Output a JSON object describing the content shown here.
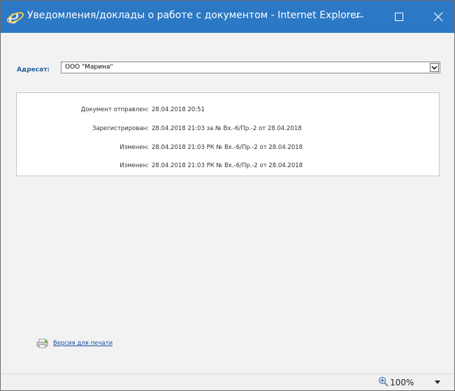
{
  "window": {
    "title": "Уведомления/доклады о работе с документом - Internet Explorer",
    "title_bar_color": "#2b78c5"
  },
  "addressee": {
    "label": "Адресат:",
    "selected_value": "ООО \"Марина\""
  },
  "notifications": [
    {
      "label": "Документ отправлен:",
      "value": "28.04.2018 20:51"
    },
    {
      "label": "Зарегистрирован:",
      "value": "28.04.2018 21:03 за № Вх.-6/Пр.-2 от 28.04.2018"
    },
    {
      "label": "Изменен:",
      "value": "28.04.2018 21:03 РК № Вх.-6/Пр.-2 от 28.04.2018"
    },
    {
      "label": "Изменен:",
      "value": "28.04.2018 21:03 РК № Вх.-6/Пр.-2 от 28.04.2018"
    }
  ],
  "print_link": {
    "label": "Версия для печати"
  },
  "statusbar": {
    "zoom": "100%"
  },
  "icons": {
    "app": "internet-explorer-icon",
    "minimize": "minimize-icon",
    "maximize": "maximize-icon",
    "close": "close-icon",
    "dropdown": "chevron-down-icon",
    "print": "printer-icon",
    "zoom": "zoom-icon"
  }
}
